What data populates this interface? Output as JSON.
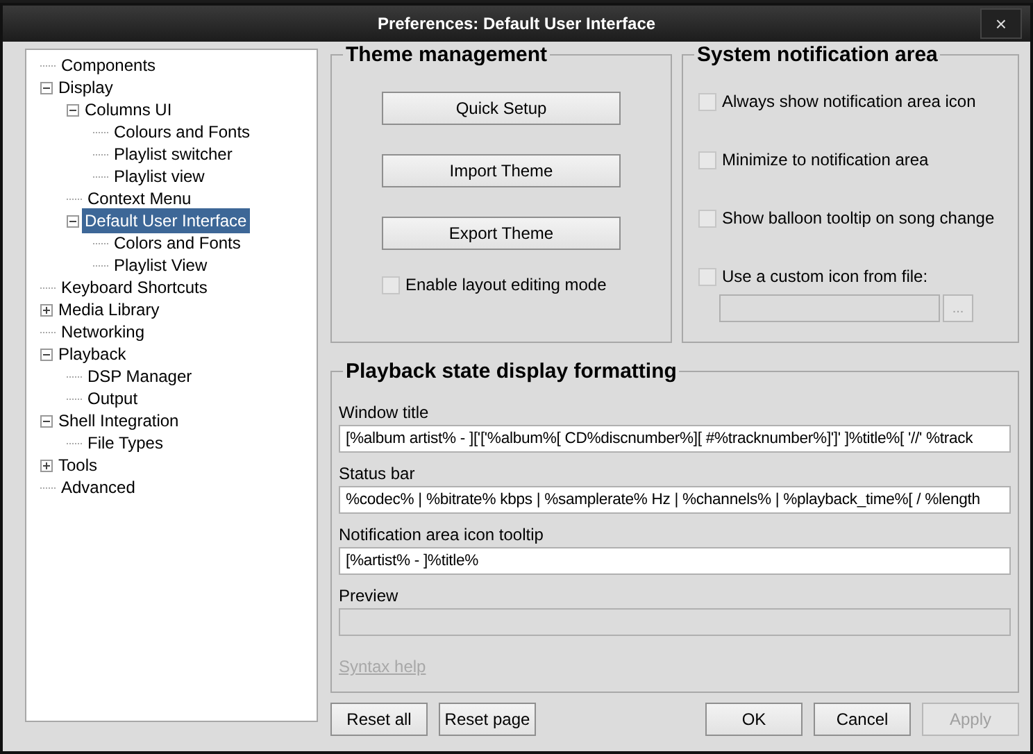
{
  "window": {
    "title": "Preferences: Default User Interface",
    "close": "×"
  },
  "tree": [
    {
      "label": "Components",
      "selected": false
    },
    {
      "label": "Display",
      "selected": false,
      "expanded": true,
      "children": [
        {
          "label": "Columns UI",
          "selected": false,
          "expanded": true,
          "children": [
            {
              "label": "Colours and Fonts",
              "selected": false
            },
            {
              "label": "Playlist switcher",
              "selected": false
            },
            {
              "label": "Playlist view",
              "selected": false
            }
          ]
        },
        {
          "label": "Context Menu",
          "selected": false
        },
        {
          "label": "Default User Interface",
          "selected": true,
          "expanded": true,
          "children": [
            {
              "label": "Colors and Fonts",
              "selected": false
            },
            {
              "label": "Playlist View",
              "selected": false
            }
          ]
        }
      ]
    },
    {
      "label": "Keyboard Shortcuts",
      "selected": false
    },
    {
      "label": "Media Library",
      "selected": false,
      "expanded": false
    },
    {
      "label": "Networking",
      "selected": false
    },
    {
      "label": "Playback",
      "selected": false,
      "expanded": true,
      "children": [
        {
          "label": "DSP Manager",
          "selected": false
        },
        {
          "label": "Output",
          "selected": false
        }
      ]
    },
    {
      "label": "Shell Integration",
      "selected": false,
      "expanded": true,
      "children": [
        {
          "label": "File Types",
          "selected": false
        }
      ]
    },
    {
      "label": "Tools",
      "selected": false,
      "expanded": false
    },
    {
      "label": "Advanced",
      "selected": false
    }
  ],
  "theme_management": {
    "title": "Theme management",
    "buttons": [
      "Quick Setup",
      "Import Theme",
      "Export Theme"
    ],
    "checkbox": {
      "label": "Enable layout editing mode",
      "checked": false
    }
  },
  "system_notification_area": {
    "title": "System notification area",
    "checkboxes": [
      {
        "label": "Always show notification area icon",
        "checked": false
      },
      {
        "label": "Minimize to notification area",
        "checked": false
      },
      {
        "label": "Show balloon tooltip on song change",
        "checked": false
      },
      {
        "label": "Use a custom icon from file:",
        "checked": false
      }
    ],
    "icon_path": {
      "disabled": true
    },
    "browse_button": {
      "label": "...",
      "disabled": true
    }
  },
  "playback_formatting": {
    "title": "Playback state display formatting",
    "fields": [
      {
        "label": "Window title",
        "value": "[%album artist% - ]['['%album%[ CD%discnumber%][ #%tracknumber%]']' ]%title%[ '//' %track",
        "disabled": false
      },
      {
        "label": "Status bar",
        "value": "%codec% | %bitrate% kbps | %samplerate% Hz | %channels% | %playback_time%[ / %length",
        "disabled": false
      },
      {
        "label": "Notification area icon tooltip",
        "value": "[%artist% - ]%title%",
        "disabled": false
      },
      {
        "label": "Preview",
        "disabled": true
      }
    ],
    "syntax_help": {
      "label": "Syntax help",
      "disabled": true
    }
  },
  "footer_buttons": [
    {
      "label": "Reset all",
      "disabled": false
    },
    {
      "label": "Reset page",
      "disabled": false
    },
    {
      "label": "OK",
      "disabled": false
    },
    {
      "label": "Cancel",
      "disabled": false
    },
    {
      "label": "Apply",
      "disabled": true
    }
  ]
}
